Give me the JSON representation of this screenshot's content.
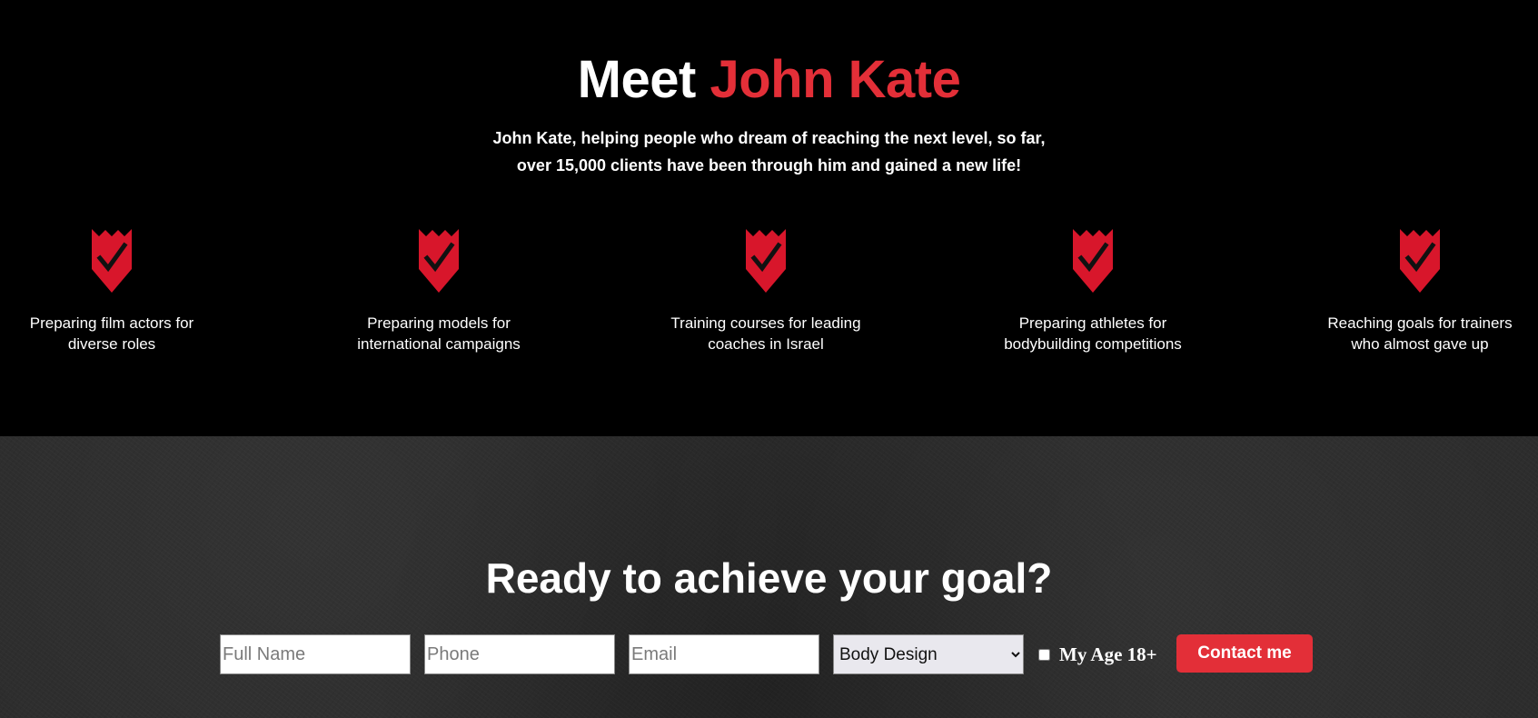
{
  "meet": {
    "title_prefix": "Meet",
    "title_name": "John Kate",
    "subtitle_line1": "John Kate, helping people who dream of reaching the next level, so far,",
    "subtitle_line2": "over 15,000 clients have been through him and gained a new life!",
    "badge_icon": "red-shield-checkmark-icon",
    "accent_color": "#e32f38",
    "features": [
      {
        "line1": "Preparing film actors for",
        "line2": "diverse roles"
      },
      {
        "line1": "Preparing models for",
        "line2": "international campaigns"
      },
      {
        "line1": "Training courses for leading",
        "line2": "coaches in Israel"
      },
      {
        "line1": "Preparing athletes for",
        "line2": "bodybuilding competitions"
      },
      {
        "line1": "Reaching goals for trainers",
        "line2": "who almost gave up"
      }
    ]
  },
  "cta": {
    "title": "Ready to achieve your goal?",
    "form": {
      "full_name_placeholder": "Full Name",
      "phone_placeholder": "Phone",
      "email_placeholder": "Email",
      "select_value": "Body Design",
      "age_label": "My Age 18+",
      "age_checked": false,
      "submit_label": "Contact me"
    }
  }
}
